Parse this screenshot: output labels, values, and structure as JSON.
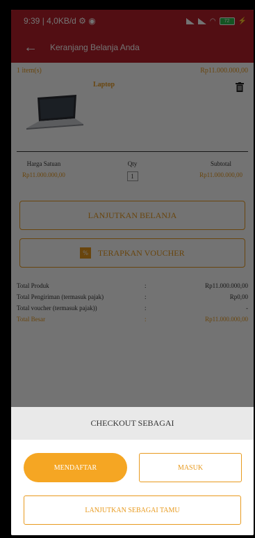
{
  "status_bar": {
    "left": "9:39 | 4,0KB/d ⚙ ◉",
    "battery": "72"
  },
  "app_bar": {
    "title": "Keranjang Belanja Anda"
  },
  "cart": {
    "items_label": "1 item(s)",
    "items_total": "Rp11.000.000,00",
    "product": {
      "name": "Laptop",
      "unit_price_header": "Harga Satuan",
      "qty_header": "Qty",
      "subtotal_header": "Subtotal",
      "unit_price": "Rp11.000.000,00",
      "qty": "1",
      "subtotal": "Rp11.000.000,00"
    }
  },
  "buttons": {
    "continue_shopping": "LANJUTKAN BELANJA",
    "voucher_badge": "%",
    "apply_voucher": "TERAPKAN VOUCHER"
  },
  "totals": [
    {
      "label": "Total Produk",
      "colon": ":",
      "value": "Rp11.000.000,00"
    },
    {
      "label": "Total Pengiriman (termasuk pajak)",
      "colon": ":",
      "value": "Rp0,00"
    },
    {
      "label": "Total voucher (termasuk pajak))",
      "colon": ":",
      "value": "-"
    },
    {
      "label": "Total Besar",
      "colon": ":",
      "value": "Rp11.000.000,00"
    }
  ],
  "sheet": {
    "title": "CHECKOUT SEBAGAI",
    "register": "MENDAFTAR",
    "login": "MASUK",
    "guest": "LANJUTKAN SEBAGAI TAMU"
  },
  "colors": {
    "header_red": "#b7212b",
    "accent_orange": "#e89a1e",
    "register_orange": "#f5a623"
  }
}
